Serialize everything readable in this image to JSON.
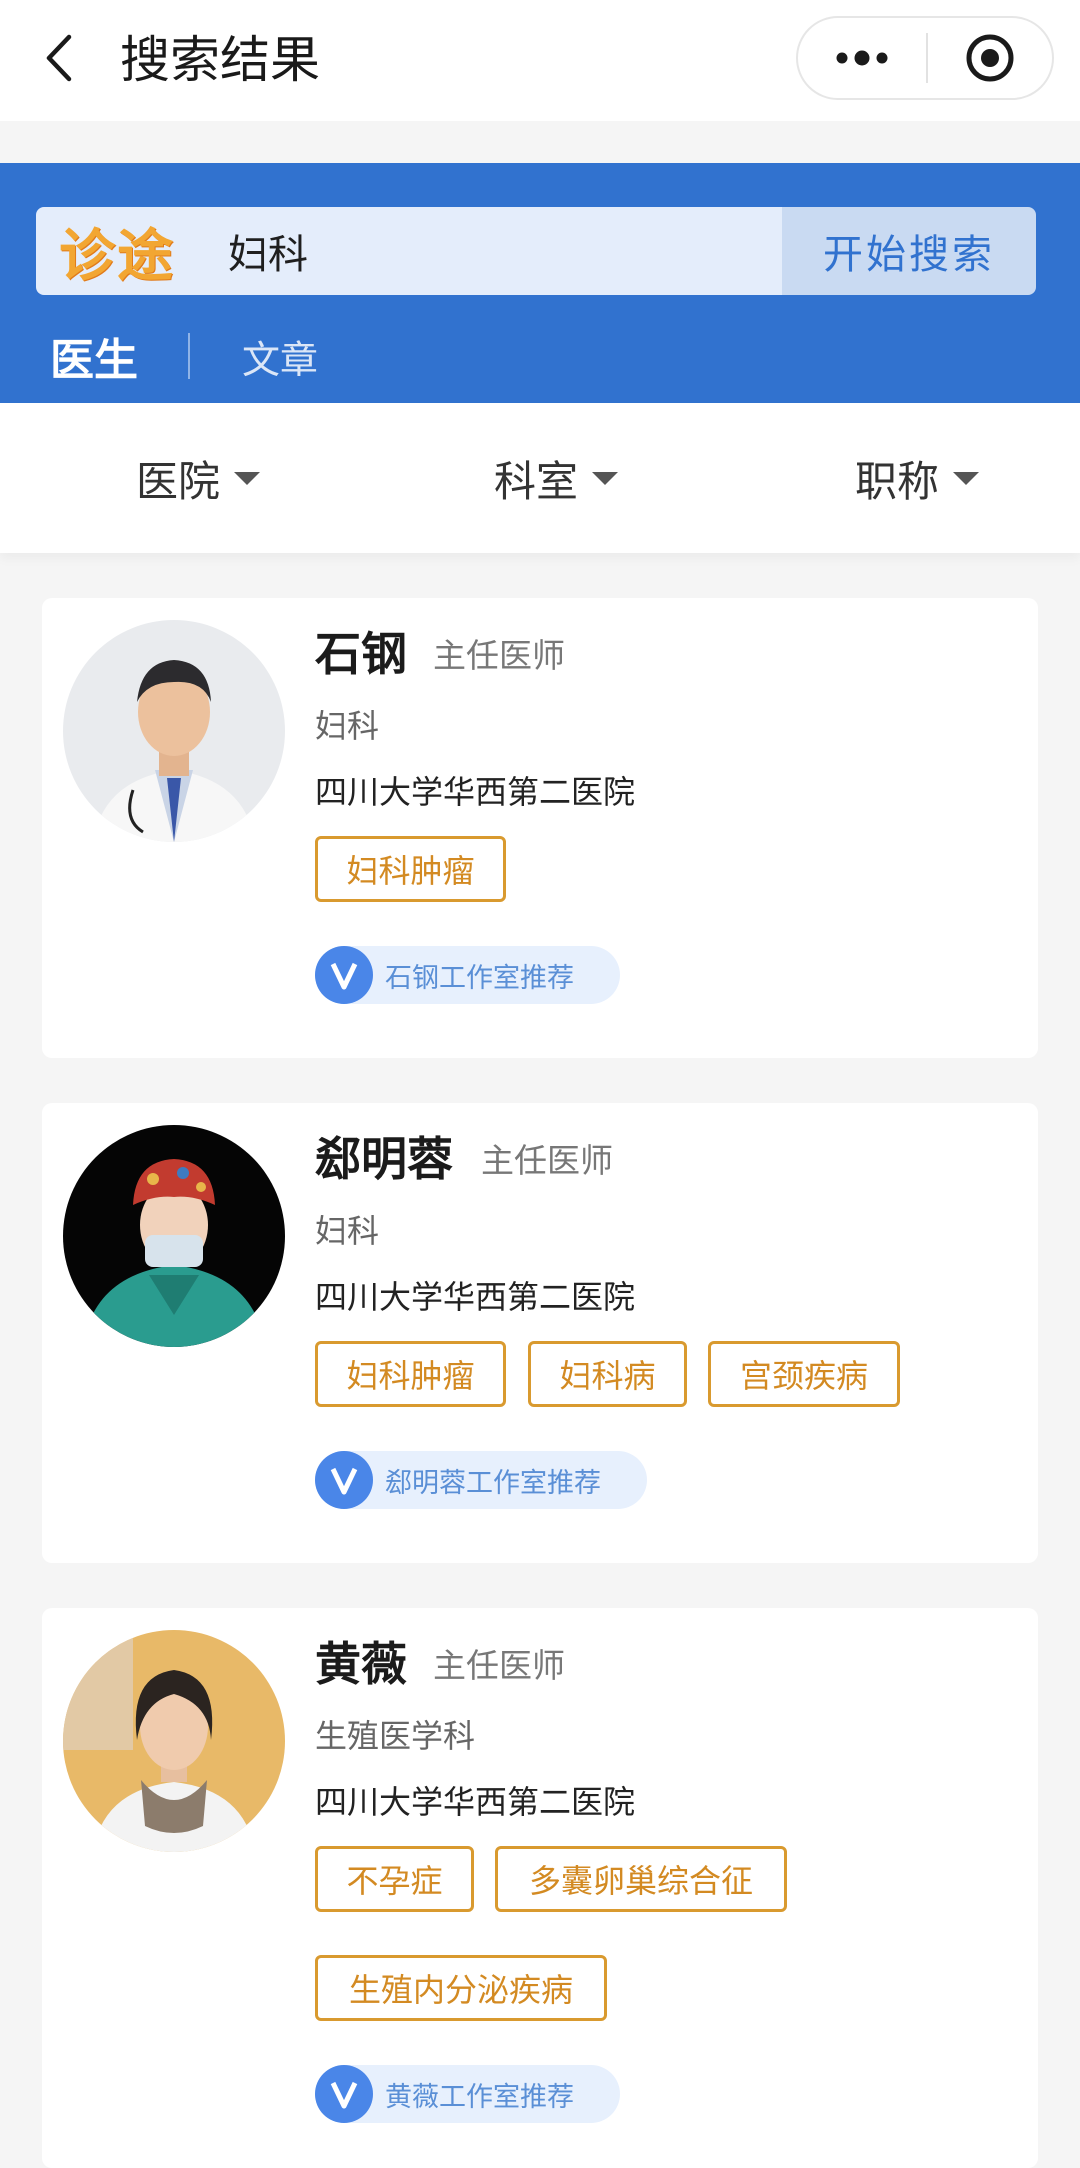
{
  "header": {
    "title": "搜索结果",
    "back_icon": "chevron-left-icon",
    "more_icon": "more-dots-icon",
    "close_icon": "target-circle-icon"
  },
  "search": {
    "brand": "诊途",
    "query": "妇科",
    "button_label": "开始搜索",
    "accent_color": "#3172cf"
  },
  "tabs": [
    {
      "label": "医生",
      "active": true
    },
    {
      "label": "文章",
      "active": false
    }
  ],
  "filters": [
    {
      "label": "医院"
    },
    {
      "label": "科室"
    },
    {
      "label": "职称"
    }
  ],
  "doctors": [
    {
      "name": "石钢",
      "title": "主任医师",
      "department": "妇科",
      "hospital": "四川大学华西第二医院",
      "tags": [
        "妇科肿瘤"
      ],
      "studio": "石钢工作室推荐"
    },
    {
      "name": "郄明蓉",
      "title": "主任医师",
      "department": "妇科",
      "hospital": "四川大学华西第二医院",
      "tags": [
        "妇科肿瘤",
        "妇科病",
        "宫颈疾病"
      ],
      "studio": "郄明蓉工作室推荐"
    },
    {
      "name": "黄薇",
      "title": "主任医师",
      "department": "生殖医学科",
      "hospital": "四川大学华西第二医院",
      "tags": [
        "不孕症",
        "多囊卵巢综合征",
        "生殖内分泌疾病"
      ],
      "studio": "黄薇工作室推荐"
    }
  ]
}
